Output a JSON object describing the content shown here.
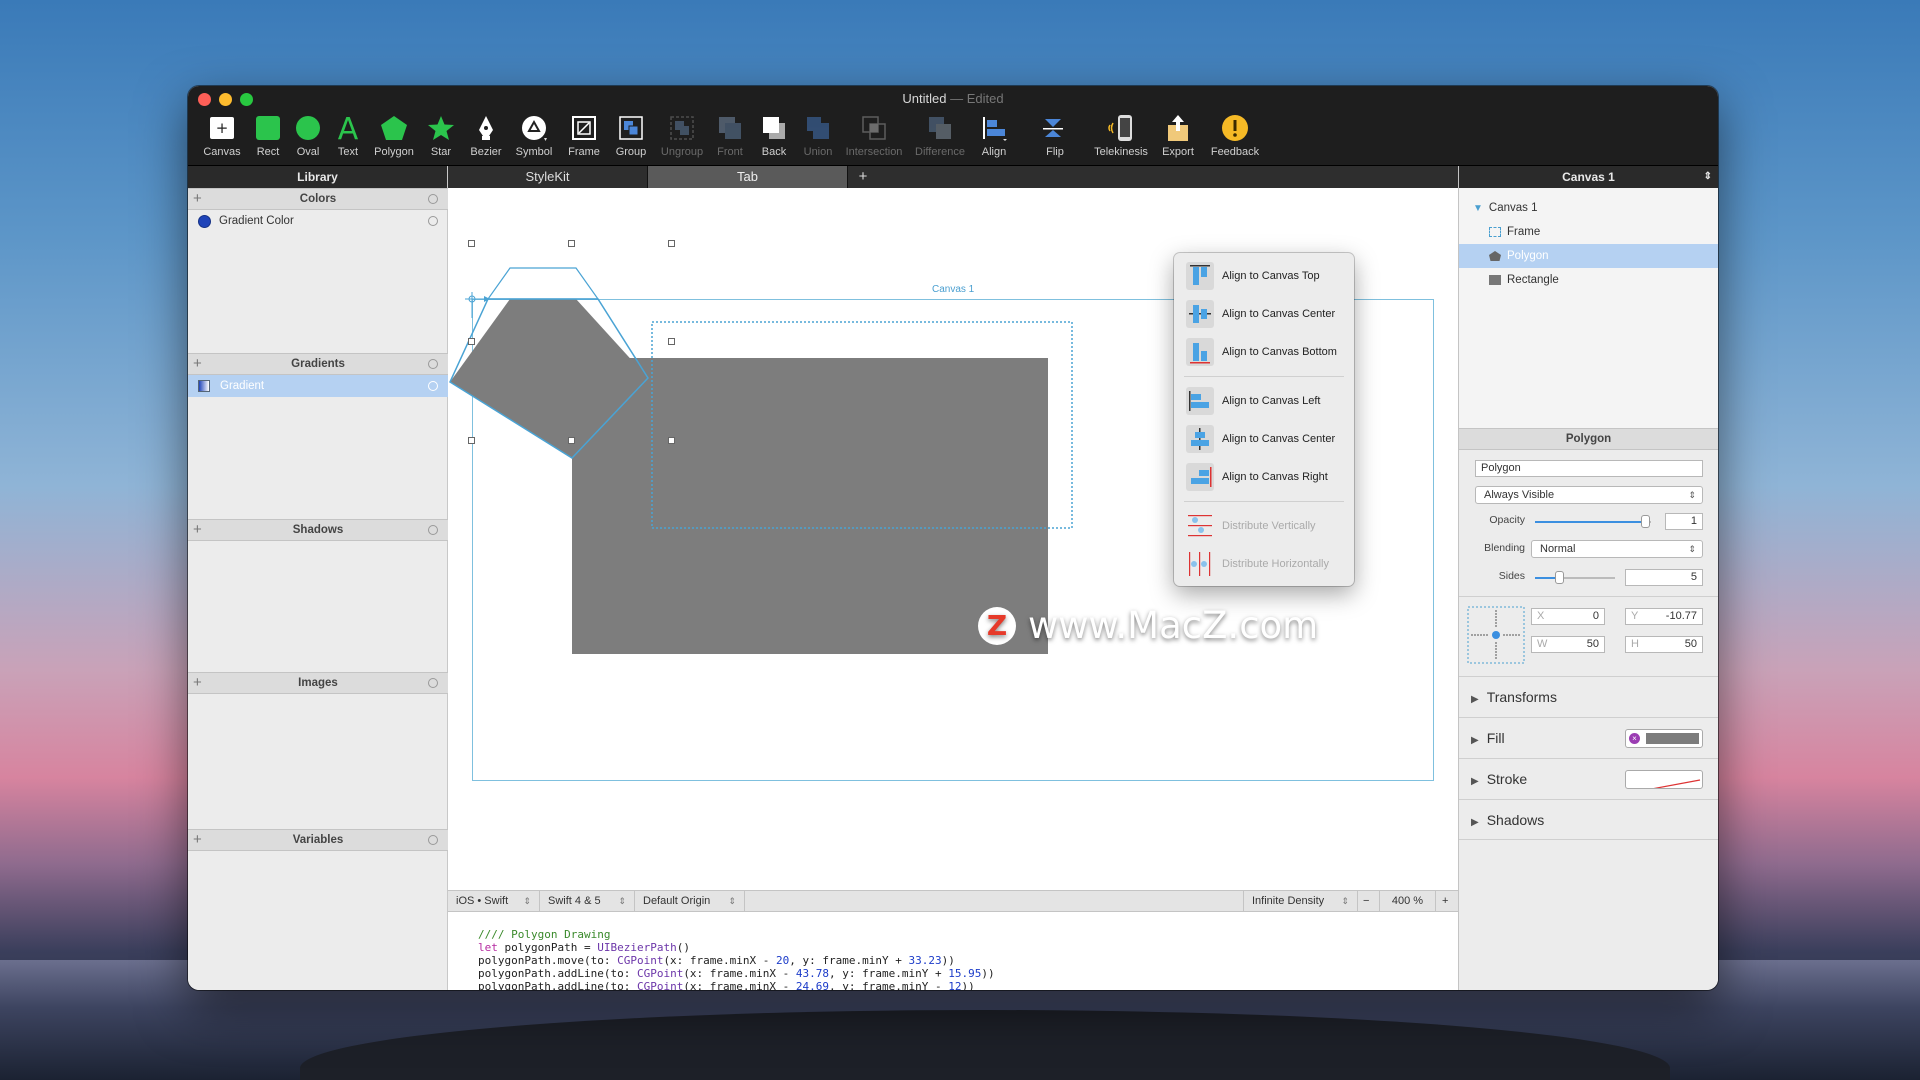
{
  "window": {
    "title": "Untitled",
    "edited": "— Edited"
  },
  "toolbar": [
    {
      "label": "Canvas"
    },
    {
      "label": "Rect"
    },
    {
      "label": "Oval"
    },
    {
      "label": "Text"
    },
    {
      "label": "Polygon"
    },
    {
      "label": "Star"
    },
    {
      "label": "Bezier"
    },
    {
      "label": "Symbol"
    },
    {
      "label": "Frame"
    },
    {
      "label": "Group"
    },
    {
      "label": "Ungroup"
    },
    {
      "label": "Front"
    },
    {
      "label": "Back"
    },
    {
      "label": "Union"
    },
    {
      "label": "Intersection"
    },
    {
      "label": "Difference"
    },
    {
      "label": "Align"
    },
    {
      "label": "Flip"
    },
    {
      "label": "Telekinesis"
    },
    {
      "label": "Export"
    },
    {
      "label": "Feedback"
    }
  ],
  "library": {
    "title": "Library",
    "sections": {
      "colors": {
        "title": "Colors",
        "items": [
          "Gradient Color"
        ]
      },
      "gradients": {
        "title": "Gradients",
        "items": [
          "Gradient"
        ]
      },
      "shadows": {
        "title": "Shadows"
      },
      "images": {
        "title": "Images"
      },
      "variables": {
        "title": "Variables"
      }
    }
  },
  "tabs": [
    {
      "label": "StyleKit"
    },
    {
      "label": "Tab"
    }
  ],
  "tab_add": "+",
  "canvas": {
    "label": "Canvas 1"
  },
  "bottombar": {
    "platform": "iOS • Swift",
    "swift": "Swift 4 & 5",
    "origin": "Default Origin",
    "density": "Infinite Density",
    "zoom_minus": "−",
    "zoom": "400 %",
    "zoom_plus": "+"
  },
  "code": {
    "line1": "//// Polygon Drawing",
    "line2_kw": "let",
    "line2_rest": " polygonPath = ",
    "line2_type": "UIBezierPath",
    "line2_end": "()",
    "line3_a": "polygonPath.move(to: ",
    "line3_type": "CGPoint",
    "line3_b": "(x: frame.minX - ",
    "line3_n1": "20",
    "line3_c": ", y: frame.minY + ",
    "line3_n2": "33.23",
    "line3_d": "))",
    "line4_a": "polygonPath.addLine(to: ",
    "line4_type": "CGPoint",
    "line4_b": "(x: frame.minX - ",
    "line4_n1": "43.78",
    "line4_c": ", y: frame.minY + ",
    "line4_n2": "15.95",
    "line4_d": "))",
    "line5_a": "polygonPath.addLine(to: ",
    "line5_type": "CGPoint",
    "line5_b": "(x: frame.minX - ",
    "line5_n1": "24.69",
    "line5_c": ", y: frame.minY - ",
    "line5_n2": "12",
    "line5_d": "))"
  },
  "inspector": {
    "title": "Canvas 1",
    "tree": [
      "Canvas 1",
      "Frame",
      "Polygon",
      "Rectangle"
    ],
    "section_title": "Polygon",
    "name_value": "Polygon",
    "visibility": "Always Visible",
    "opacity_label": "Opacity",
    "opacity_value": "1",
    "opacity_level": 0.95,
    "blending_label": "Blending",
    "blending_value": "Normal",
    "sides_label": "Sides",
    "sides_value": "5",
    "x_label": "X",
    "x_value": "0",
    "y_label": "Y",
    "y_value": "-10.77",
    "w_label": "W",
    "w_value": "50",
    "h_label": "H",
    "h_value": "50",
    "transforms": "Transforms",
    "fill": "Fill",
    "stroke": "Stroke",
    "shadows": "Shadows"
  },
  "align_menu": {
    "items": [
      {
        "label": "Align to Canvas Top",
        "enabled": true
      },
      {
        "label": "Align to Canvas Center",
        "enabled": true
      },
      {
        "label": "Align to Canvas Bottom",
        "enabled": true
      },
      {
        "label": "Align to Canvas Left",
        "enabled": true
      },
      {
        "label": "Align to Canvas Center",
        "enabled": true
      },
      {
        "label": "Align to Canvas Right",
        "enabled": true
      },
      {
        "label": "Distribute Vertically",
        "enabled": false
      },
      {
        "label": "Distribute Horizontally",
        "enabled": false
      }
    ]
  },
  "watermark": {
    "logo": "Z",
    "text": "www.MacZ.com"
  },
  "colors": {
    "accent": "#3b8fe0",
    "selection": "#b5d1f2",
    "shape_fill": "#7d7d7d",
    "toolbar_bg": "#1e1e1e"
  }
}
